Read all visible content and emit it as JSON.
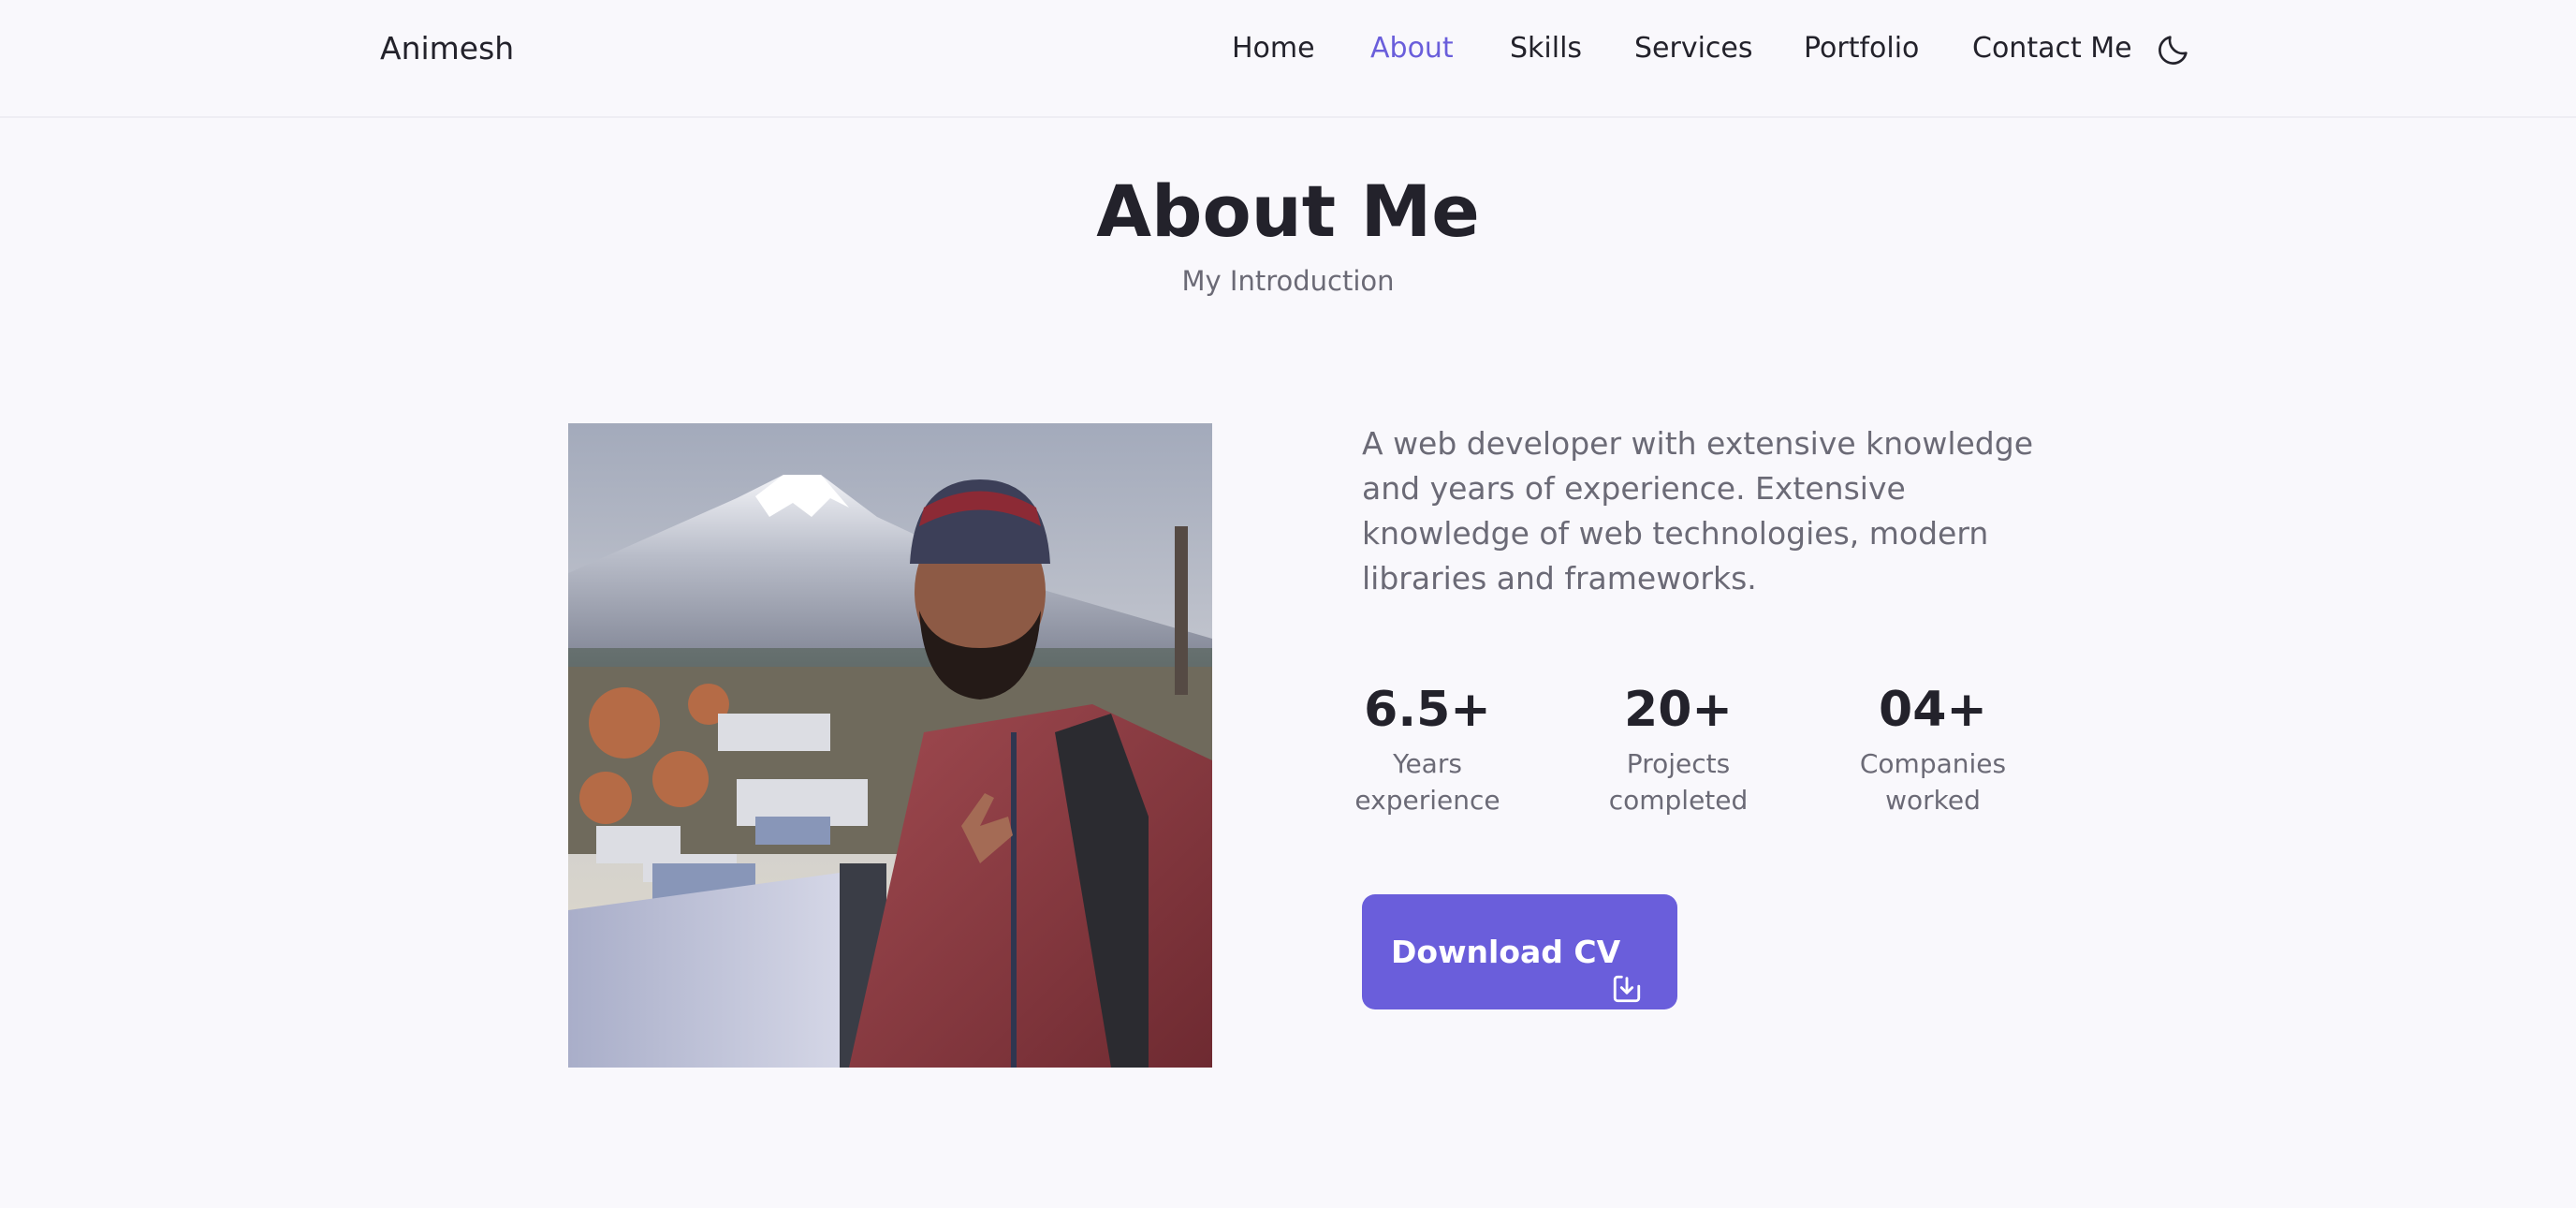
{
  "header": {
    "logo": "Animesh",
    "nav": [
      "Home",
      "About",
      "Skills",
      "Services",
      "Portfolio",
      "Contact Me"
    ],
    "active_nav": "About",
    "theme_icon": "moon-icon"
  },
  "about": {
    "title": "About Me",
    "subtitle": "My Introduction",
    "description": "A web developer with extensive knowledge and years of experience. Extensive knowledge of web technologies, modern libraries and frameworks.",
    "stats": [
      {
        "value": "6.5+",
        "label": "Years\nexperience"
      },
      {
        "value": "20+",
        "label": "Projects\ncompleted"
      },
      {
        "value": "04+",
        "label": "Companies\nworked"
      }
    ],
    "button": {
      "label": "Download CV",
      "icon": "download-icon"
    }
  },
  "colors": {
    "accent": "#6a5edb",
    "background": "#f9f8fc",
    "text": "#23222b",
    "muted": "#6b6a76"
  }
}
